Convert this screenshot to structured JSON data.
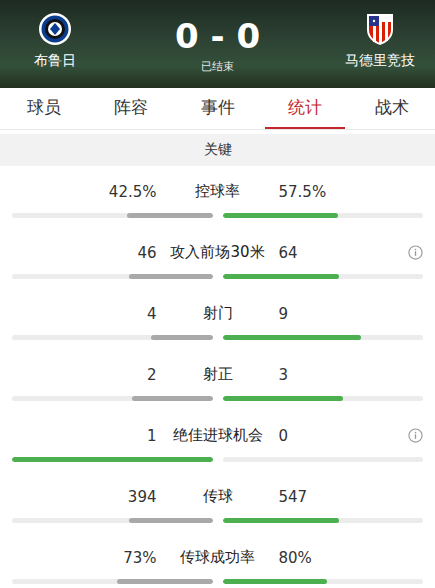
{
  "match": {
    "home": {
      "name": "布鲁日"
    },
    "away": {
      "name": "马德里竞技"
    },
    "score": "0 - 0",
    "status": "已结束"
  },
  "tabs": [
    {
      "label": "球员",
      "selected": false
    },
    {
      "label": "阵容",
      "selected": false
    },
    {
      "label": "事件",
      "selected": false
    },
    {
      "label": "统计",
      "selected": true
    },
    {
      "label": "战术",
      "selected": false
    }
  ],
  "section": {
    "title": "关键"
  },
  "stats": [
    {
      "label": "控球率",
      "info": false,
      "left": {
        "value": "42.5%",
        "level": 0.425,
        "highlighted": false
      },
      "right": {
        "value": "57.5%",
        "level": 0.575,
        "highlighted": true
      }
    },
    {
      "label": "攻入前场30米",
      "info": true,
      "left": {
        "value": "46",
        "level": 0.418,
        "highlighted": false
      },
      "right": {
        "value": "64",
        "level": 0.582,
        "highlighted": true
      }
    },
    {
      "label": "射门",
      "info": false,
      "left": {
        "value": "4",
        "level": 0.308,
        "highlighted": false
      },
      "right": {
        "value": "9",
        "level": 0.692,
        "highlighted": true
      }
    },
    {
      "label": "射正",
      "info": false,
      "left": {
        "value": "2",
        "level": 0.4,
        "highlighted": false
      },
      "right": {
        "value": "3",
        "level": 0.6,
        "highlighted": true
      }
    },
    {
      "label": "绝佳进球机会",
      "info": true,
      "left": {
        "value": "1",
        "level": 1,
        "highlighted": true
      },
      "right": {
        "value": "0",
        "level": 0,
        "highlighted": false
      }
    },
    {
      "label": "传球",
      "info": false,
      "left": {
        "value": "394",
        "level": 0.419,
        "highlighted": false
      },
      "right": {
        "value": "547",
        "level": 0.581,
        "highlighted": true
      }
    },
    {
      "label": "传球成功率",
      "info": false,
      "left": {
        "value": "73%",
        "level": 0.477,
        "highlighted": false
      },
      "right": {
        "value": "80%",
        "level": 0.523,
        "highlighted": true
      }
    }
  ]
}
